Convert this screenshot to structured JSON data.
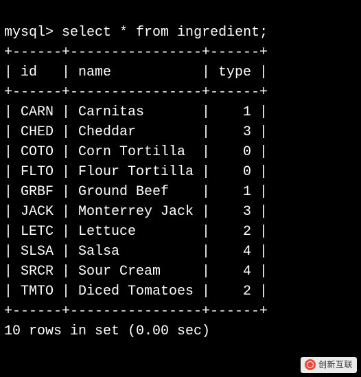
{
  "prompt": "mysql>",
  "query": "select * from ingredient;",
  "table": {
    "border_top": "+------+----------------+------+",
    "header_row": "| id   | name           | type |",
    "rows": [
      {
        "id": "CARN",
        "name": "Carnitas",
        "type": 1
      },
      {
        "id": "CHED",
        "name": "Cheddar",
        "type": 3
      },
      {
        "id": "COTO",
        "name": "Corn Tortilla",
        "type": 0
      },
      {
        "id": "FLTO",
        "name": "Flour Tortilla",
        "type": 0
      },
      {
        "id": "GRBF",
        "name": "Ground Beef",
        "type": 1
      },
      {
        "id": "JACK",
        "name": "Monterrey Jack",
        "type": 3
      },
      {
        "id": "LETC",
        "name": "Lettuce",
        "type": 2
      },
      {
        "id": "SLSA",
        "name": "Salsa",
        "type": 4
      },
      {
        "id": "SRCR",
        "name": "Sour Cream",
        "type": 4
      },
      {
        "id": "TMTO",
        "name": "Diced Tomatoes",
        "type": 2
      }
    ]
  },
  "status": "10 rows in set (0.00 sec)",
  "watermark": "创新互联"
}
